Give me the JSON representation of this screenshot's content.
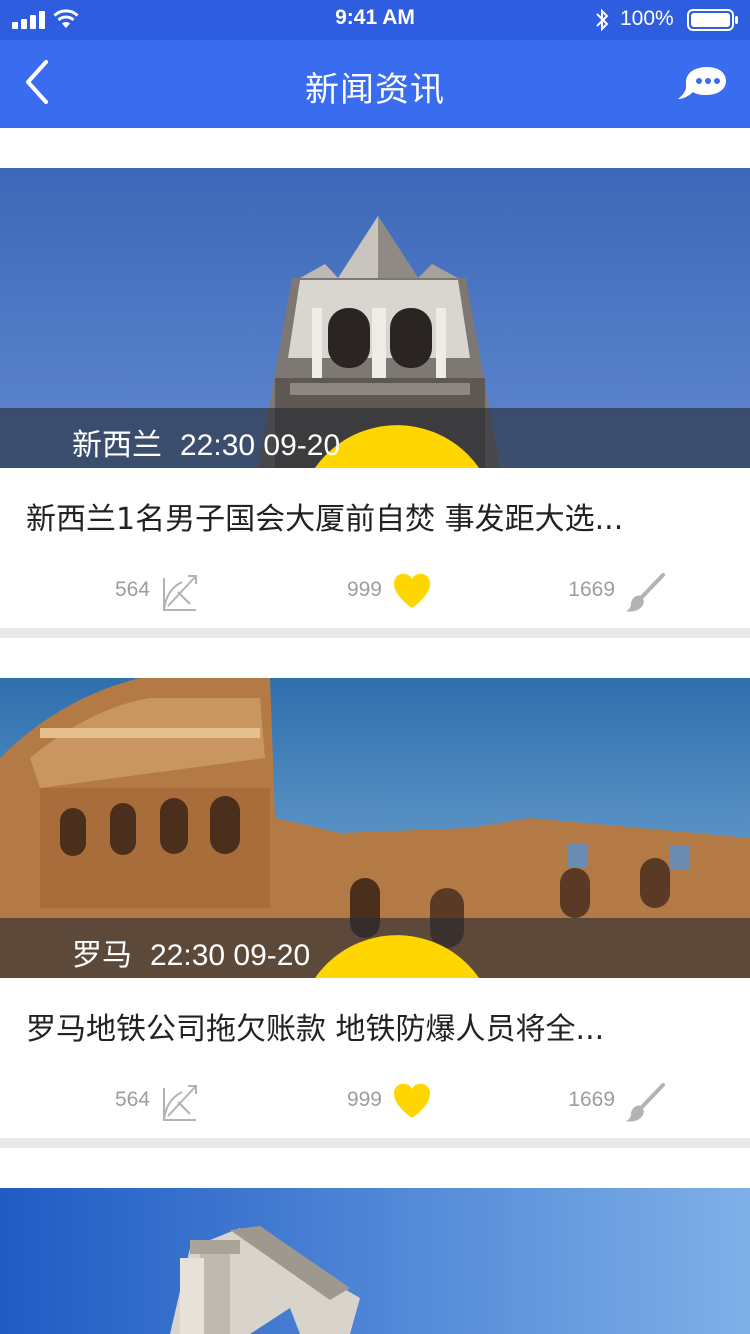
{
  "status_bar": {
    "time": "9:41 AM",
    "battery": "100%"
  },
  "nav": {
    "title": "新闻资讯",
    "back_icon": "chevron-left-icon",
    "chat_icon": "chat-bubble-icon"
  },
  "colors": {
    "status_bar_bg": "#2f5de0",
    "nav_bg": "#3a6cf0",
    "pin": "#ffd600",
    "heart": "#ffd600",
    "stat_text": "#9d9d9d"
  },
  "cards": [
    {
      "location": "新西兰",
      "time": "22:30 09-20",
      "headline": "新西兰1名男子国会大厦前自焚 事发距大选...",
      "shares": "564",
      "likes": "999",
      "comments": "1669"
    },
    {
      "location": "罗马",
      "time": "22:30 09-20",
      "headline": "罗马地铁公司拖欠账款 地铁防爆人员将全...",
      "shares": "564",
      "likes": "999",
      "comments": "1669"
    },
    {
      "location": "",
      "time": "",
      "headline": ""
    }
  ]
}
